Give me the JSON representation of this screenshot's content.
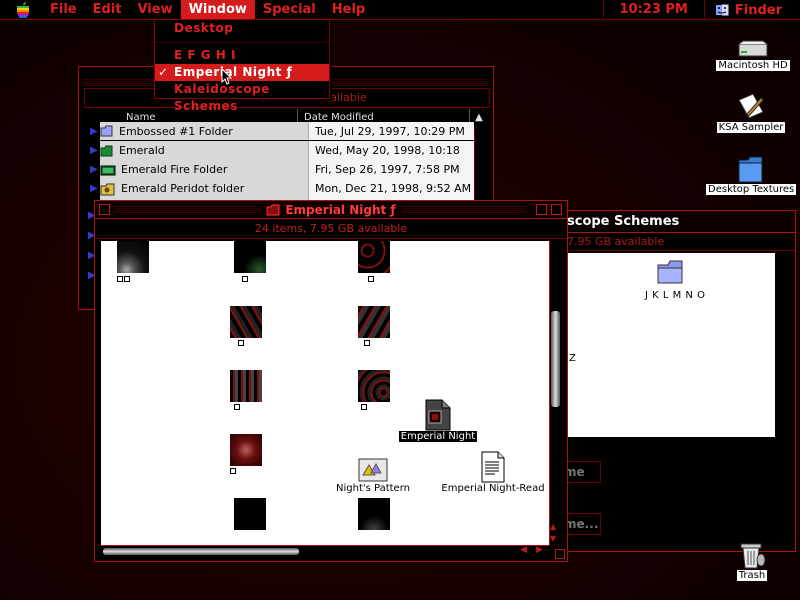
{
  "menubar": {
    "items": [
      "File",
      "Edit",
      "View",
      "Window",
      "Special",
      "Help"
    ],
    "active": "Window",
    "clock": "10:23 PM",
    "app": "Finder"
  },
  "window_menu": {
    "items": [
      "Desktop",
      "E F G H I",
      "Emperial Night ƒ",
      "Kaleidoscope Schemes"
    ],
    "selected": "Emperial Night ƒ",
    "checked": "✓"
  },
  "list_window": {
    "info": "778 items, 7.95 GB available",
    "columns": [
      "Name",
      "Date Modified"
    ],
    "sort_arrow": "▲",
    "rows": [
      {
        "name": "Embossed #1 Folder",
        "date": "Tue, Jul 29, 1997, 10:29 PM"
      },
      {
        "name": "Emerald",
        "date": "Wed, May 20, 1998, 10:18 AM"
      },
      {
        "name": "Emerald Fire Folder",
        "date": "Fri, Sep 26, 1997, 7:58 PM"
      },
      {
        "name": "Emerald Peridot folder",
        "date": "Mon, Dec 21, 1998, 9:52 AM"
      }
    ]
  },
  "emperial_window": {
    "title": "Emperial Night ƒ",
    "info": "24 items, 7.95 GB available",
    "icons": {
      "selected_label": "Emperial Night",
      "pattern_label": "Night's Pattern",
      "readme_label": "Emperial Night-Read"
    }
  },
  "kaleido_window": {
    "title_fragment": "scope Schemes",
    "info_fragment": "7.95 GB available",
    "folder_label": "J K L M N O",
    "z_label": "Z",
    "btn1": "me",
    "btn2": "me..."
  },
  "desktop": {
    "hd": "Macintosh HD",
    "ksa": "KSA Sampler",
    "textures": "Desktop Textures",
    "trash": "Trash"
  },
  "colors": {
    "accent": "#d41c1c",
    "bg": "#140000"
  }
}
